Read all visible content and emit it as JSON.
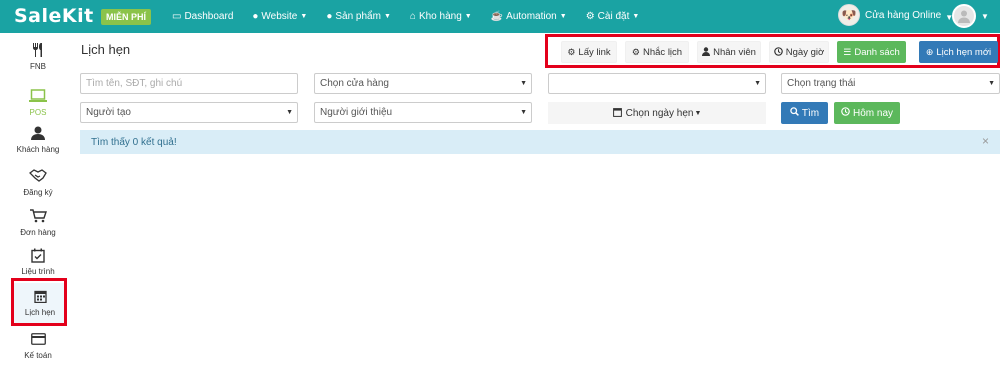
{
  "brand": {
    "logo": "SaleKit",
    "free_badge": "MIỄN PHÍ"
  },
  "nav": [
    {
      "icon": "monitor-icon",
      "label": "Dashboard",
      "has_caret": false
    },
    {
      "icon": "globe-icon",
      "label": "Website",
      "has_caret": true
    },
    {
      "icon": "product-icon",
      "label": "Sản phẩm",
      "has_caret": true
    },
    {
      "icon": "home-icon",
      "label": "Kho hàng",
      "has_caret": true
    },
    {
      "icon": "coffee-icon",
      "label": "Automation",
      "has_caret": true
    },
    {
      "icon": "gear-icon",
      "label": "Cài đặt",
      "has_caret": true
    }
  ],
  "store": {
    "name": "Cửa hàng Online"
  },
  "sidebar": [
    {
      "icon": "fork-knife-icon",
      "label": "FNB"
    },
    {
      "icon": "laptop-icon",
      "label": "POS"
    },
    {
      "icon": "user-icon",
      "label": "Khách hàng"
    },
    {
      "icon": "handshake-icon",
      "label": "Đăng ký"
    },
    {
      "icon": "cart-icon",
      "label": "Đơn hàng"
    },
    {
      "icon": "calendar-check-icon",
      "label": "Liệu trình"
    },
    {
      "icon": "calendar-icon",
      "label": "Lịch hẹn"
    },
    {
      "icon": "credit-card-icon",
      "label": "Kế toán"
    }
  ],
  "page": {
    "title": "Lịch hẹn"
  },
  "actions": {
    "get_link": "Lấy link",
    "reminder": "Nhắc lịch",
    "staff": "Nhân viên",
    "datetime": "Ngày giờ",
    "list": "Danh sách",
    "new_appointment": "Lịch hẹn mới"
  },
  "filters": {
    "search_placeholder": "Tìm tên, SĐT, ghi chú",
    "store_select": "Chọn cửa hàng",
    "blank_select": "",
    "status_select": "Chọn trạng thái",
    "creator_select": "Người tạo",
    "referrer_select": "Người giới thiệu",
    "date_button": "Chọn ngày hẹn",
    "search_button": "Tìm",
    "today_button": "Hôm nay"
  },
  "alert": {
    "message": "Tìm thấy 0 kết quả!",
    "close": "×"
  },
  "colors": {
    "topbar": "#1aa3a3",
    "accent_green": "#5cb85c",
    "accent_blue": "#337ab7",
    "highlight": "#e3001b",
    "alert_bg": "#d9edf7"
  }
}
